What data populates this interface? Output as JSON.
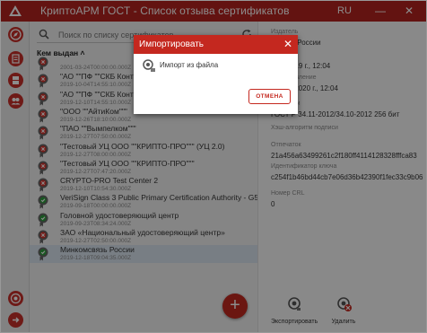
{
  "window": {
    "title": "КриптоАРМ ГОСТ - Список отзыва сертификатов",
    "language": "RU",
    "minimize_glyph": "—",
    "close_glyph": "✕"
  },
  "sidebar": {
    "icons": [
      "compass-icon",
      "document-icon",
      "server-icon",
      "users-icon",
      "help-icon",
      "exit-icon"
    ]
  },
  "list": {
    "search_placeholder": "Поиск по списку сертификатов",
    "header": "Кем выдан ˄",
    "items": [
      {
        "name": "",
        "date": "2001-03-24T00:00:00.000Z",
        "status": "invalid"
      },
      {
        "name": "\"АО \"\"ПФ \"\"СКБ Контур\"\"\"",
        "date": "2019-10-04T14:55:10.000Z",
        "status": "invalid"
      },
      {
        "name": "\"АО \"\"ПФ \"\"СКБ Контур\"\"\"",
        "date": "2019-12-10T14:55:10.000Z",
        "status": "invalid"
      },
      {
        "name": "\"ООО \"\"АйтиКом\"\"\"",
        "date": "2019-12-26T18:10:00.000Z",
        "status": "invalid"
      },
      {
        "name": "\"ПАО \"\"Вымпелком\"\"\"",
        "date": "2019-12-27T07:50:00.000Z",
        "status": "invalid"
      },
      {
        "name": "\"Тестовый УЦ ООО \"\"КРИПТО-ПРО\"\"\" (УЦ 2.0)",
        "date": "2019-12-27T08:00:00.000Z",
        "status": "invalid"
      },
      {
        "name": "\"Тестовый УЦ ООО \"\"КРИПТО-ПРО\"\"\"",
        "date": "2019-12-27T07:47:20.000Z",
        "status": "invalid"
      },
      {
        "name": "CRYPTO-PRO Test Center 2",
        "date": "2019-12-10T10:54:30.000Z",
        "status": "invalid"
      },
      {
        "name": "VeriSign Class 3 Public Primary Certification Authority - G5",
        "date": "2019-09-18T00:00:00.000Z",
        "status": "valid"
      },
      {
        "name": "Головной удостоверяющий центр",
        "date": "2019-09-23T08:34:24.000Z",
        "status": "valid"
      },
      {
        "name": "ЗАО «Национальный удостоверяющий центр»",
        "date": "2019-12-27T02:50:00.000Z",
        "status": "invalid"
      },
      {
        "name": "Минкомсвязь России",
        "date": "2019-12-18T09:04:35.000Z",
        "status": "valid"
      }
    ],
    "selected_index": 11,
    "add_glyph": "+"
  },
  "details": {
    "fields": [
      {
        "label": "Издатель",
        "value": "...связь России"
      },
      {
        "label": "...лен с",
        "value": "...ря 2019 г., 12:04"
      },
      {
        "label": "...е обновление",
        "value": "...ваня 2020 г., 12:04"
      },
      {
        "label": "...подписи",
        "value": "ГОСТ Р 34.11-2012/34.10-2012 256 бит"
      },
      {
        "label": "Хэш-алгоритм подписи",
        "value": ""
      },
      {
        "label": "Отпечаток",
        "value": "21a456a63499261c2f180ff4114128328fffca83"
      },
      {
        "label": "Идентификатор ключа",
        "value": "c254f1b46bd44cb7e06d36b42390f1fec33c9b06"
      },
      {
        "label": "Номер CRL",
        "value": "0"
      }
    ],
    "export_label": "Экспортировать",
    "delete_label": "Удалить"
  },
  "dialog": {
    "title": "Импортировать",
    "close_glyph": "✕",
    "item_label": "Импорт из файла",
    "cancel_label": "ОТМЕНА"
  },
  "colors": {
    "accent": "#c4281f",
    "valid": "#2e9e3e",
    "invalid": "#d6322a",
    "selected_row": "#dbe6f1"
  }
}
